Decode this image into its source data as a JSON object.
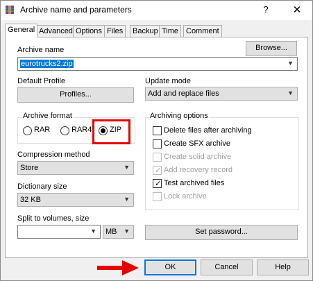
{
  "window": {
    "title": "Archive name and parameters",
    "help_glyph": "?",
    "close_glyph": "✕"
  },
  "tabs": [
    "General",
    "Advanced",
    "Options",
    "Files",
    "Backup",
    "Time",
    "Comment"
  ],
  "archive_name": {
    "label": "Archive name",
    "value": "eurotrucks2.zip",
    "browse_label": "Browse..."
  },
  "default_profile": {
    "label": "Default Profile",
    "button_label": "Profiles..."
  },
  "update_mode": {
    "label": "Update mode",
    "value": "Add and replace files"
  },
  "archive_format": {
    "label": "Archive format",
    "options": [
      {
        "label": "RAR",
        "selected": false
      },
      {
        "label": "RAR4",
        "selected": false
      },
      {
        "label": "ZIP",
        "selected": true
      }
    ]
  },
  "compression_method": {
    "label": "Compression method",
    "value": "Store"
  },
  "dictionary_size": {
    "label": "Dictionary size",
    "value": "32 KB"
  },
  "split_volumes": {
    "label": "Split to volumes, size",
    "value": "",
    "unit": "MB"
  },
  "archiving_options": {
    "label": "Archiving options",
    "items": [
      {
        "label": "Delete files after archiving",
        "checked": false,
        "enabled": true
      },
      {
        "label": "Create SFX archive",
        "checked": false,
        "enabled": true
      },
      {
        "label": "Create solid archive",
        "checked": false,
        "enabled": false
      },
      {
        "label": "Add recovery record",
        "checked": true,
        "enabled": false
      },
      {
        "label": "Test archived files",
        "checked": true,
        "enabled": true
      },
      {
        "label": "Lock archive",
        "checked": false,
        "enabled": false
      }
    ]
  },
  "set_password_label": "Set password...",
  "footer": {
    "ok_label": "OK",
    "cancel_label": "Cancel",
    "help_label": "Help"
  },
  "colors": {
    "highlight": "#e60000",
    "selection": "#0078d7"
  },
  "icons": {
    "app": "winrar-icon",
    "arrow": "red-arrow-icon",
    "dropdown": "chevron-down-icon"
  }
}
